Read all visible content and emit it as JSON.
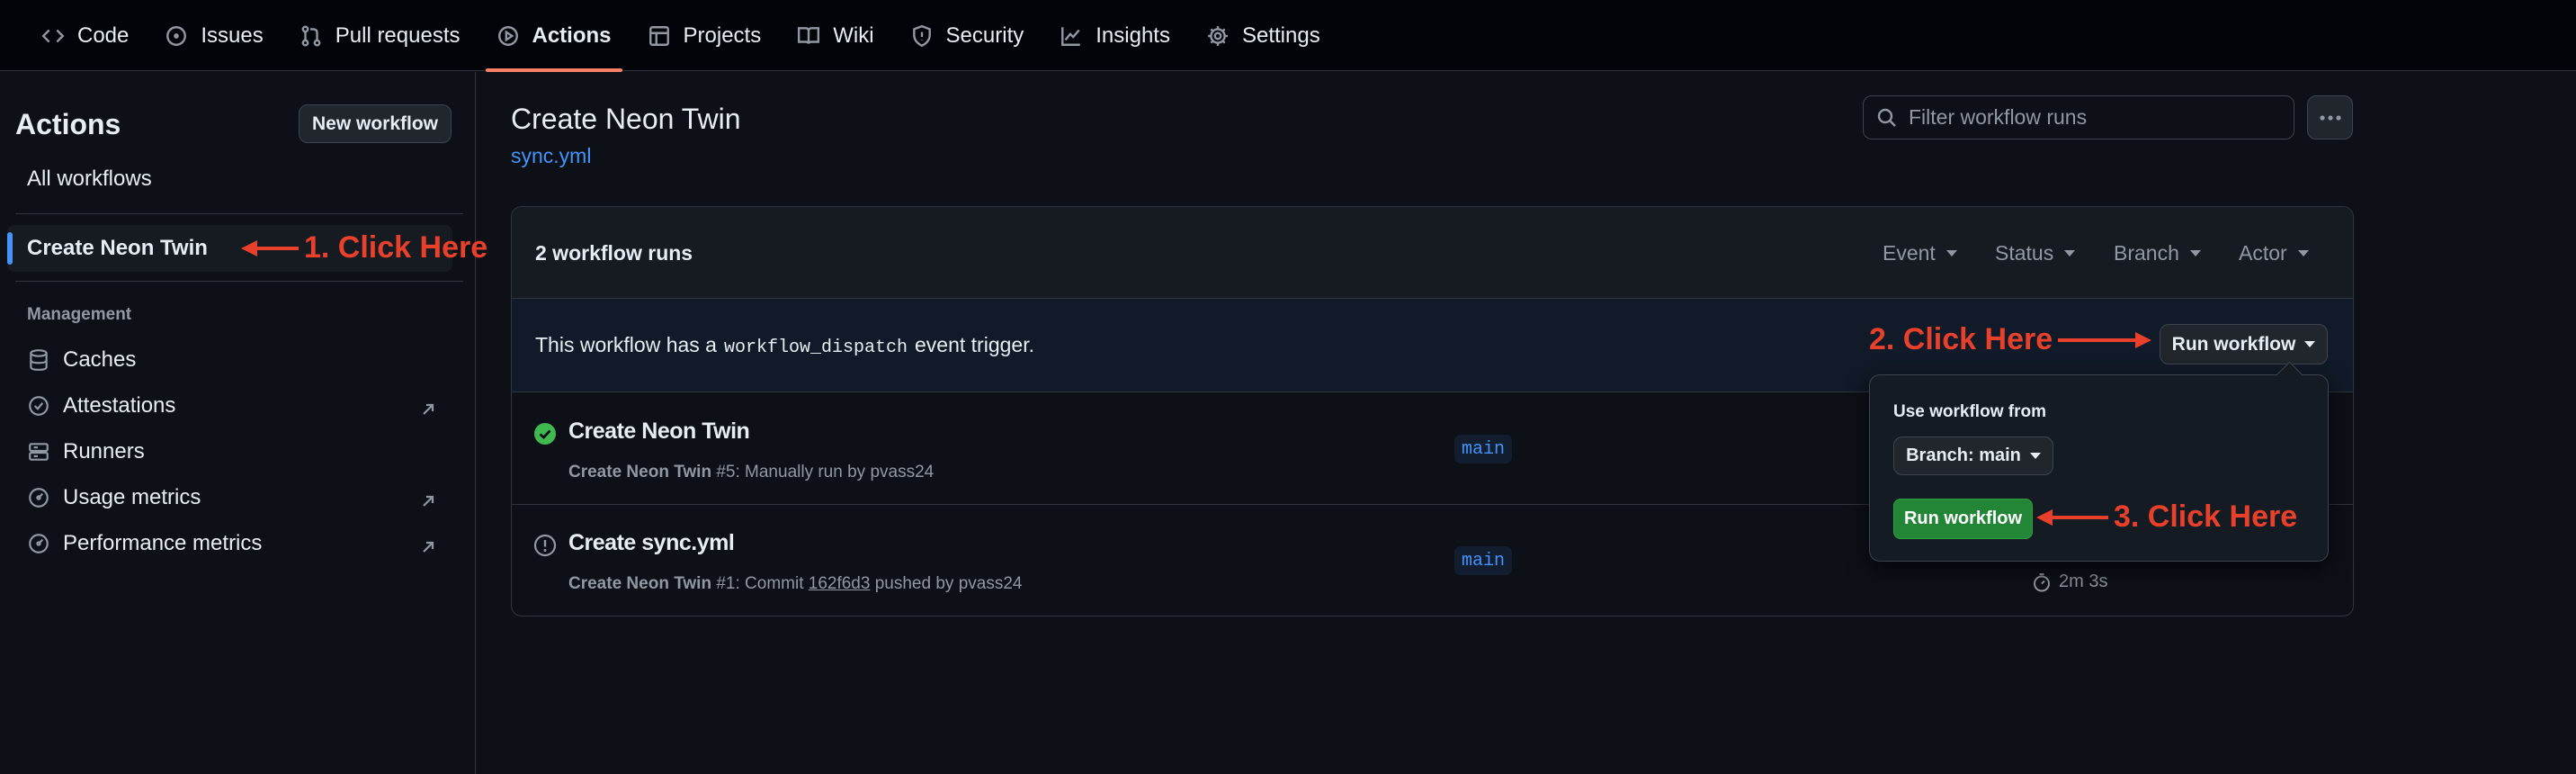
{
  "topnav": {
    "tabs": [
      {
        "label": "Code",
        "icon": "code-icon"
      },
      {
        "label": "Issues",
        "icon": "issue-icon"
      },
      {
        "label": "Pull requests",
        "icon": "pull-request-icon"
      },
      {
        "label": "Actions",
        "icon": "play-icon",
        "active": true
      },
      {
        "label": "Projects",
        "icon": "table-icon"
      },
      {
        "label": "Wiki",
        "icon": "book-icon"
      },
      {
        "label": "Security",
        "icon": "shield-icon"
      },
      {
        "label": "Insights",
        "icon": "graph-icon"
      },
      {
        "label": "Settings",
        "icon": "gear-icon"
      }
    ]
  },
  "sidebar": {
    "title": "Actions",
    "new_workflow_label": "New workflow",
    "all_workflows_label": "All workflows",
    "selected_workflow": "Create Neon Twin",
    "management_heading": "Management",
    "management_items": [
      {
        "label": "Caches",
        "icon": "database-icon",
        "external": false
      },
      {
        "label": "Attestations",
        "icon": "verified-icon",
        "external": true
      },
      {
        "label": "Runners",
        "icon": "server-icon",
        "external": false
      },
      {
        "label": "Usage metrics",
        "icon": "meter-icon",
        "external": true
      },
      {
        "label": "Performance metrics",
        "icon": "meter-icon",
        "external": true
      }
    ]
  },
  "main": {
    "title": "Create Neon Twin",
    "file": "sync.yml",
    "filter_placeholder": "Filter workflow runs",
    "runs_count": "2 workflow runs",
    "filters": [
      "Event",
      "Status",
      "Branch",
      "Actor"
    ],
    "dispatch": {
      "text_before": "This workflow has a",
      "code": "workflow_dispatch",
      "text_after": "event trigger.",
      "run_button_label": "Run workflow"
    },
    "runs": [
      {
        "title": "Create Neon Twin",
        "status": "success",
        "meta_workflow": "Create Neon Twin",
        "meta_number": "#5",
        "meta_text": ": Manually run by pvass24",
        "branch": "main"
      },
      {
        "title": "Create sync.yml",
        "status": "attention",
        "meta_workflow": "Create Neon Twin",
        "meta_number": "#1",
        "meta_text_before": ": Commit ",
        "meta_sha": "162f6d3",
        "meta_text_after": " pushed by pvass24",
        "branch": "main",
        "duration": "2m 3s"
      }
    ]
  },
  "popover": {
    "label": "Use workflow from",
    "branch_button_label": "Branch: main",
    "run_button_label": "Run workflow"
  },
  "annotations": {
    "step1": "1. Click Here",
    "step2": "2. Click Here",
    "step3": "3. Click Here",
    "color": "#e8402a"
  },
  "colors": {
    "accent_link": "#4493f8",
    "success": "#3fb950",
    "primary_button": "#238636",
    "active_tab_underline": "#f78166"
  }
}
